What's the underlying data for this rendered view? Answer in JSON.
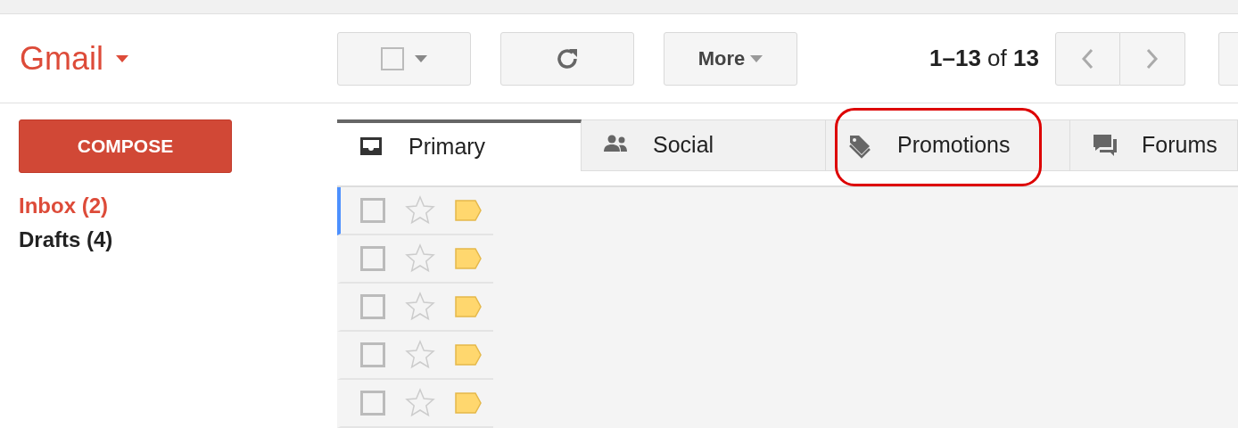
{
  "app": {
    "logo": "Gmail"
  },
  "toolbar": {
    "more_label": "More",
    "page_range": "1–13",
    "page_of": "of",
    "page_total": "13"
  },
  "sidebar": {
    "compose_label": "COMPOSE",
    "items": [
      {
        "label": "Inbox (2)",
        "selected": true
      },
      {
        "label": "Drafts (4)",
        "selected": false
      }
    ]
  },
  "tabs": [
    {
      "kind": "primary",
      "label": "Primary",
      "selected": true,
      "highlighted": false
    },
    {
      "kind": "social",
      "label": "Social",
      "selected": false,
      "highlighted": false
    },
    {
      "kind": "promotions",
      "label": "Promotions",
      "selected": false,
      "highlighted": true
    },
    {
      "kind": "forums",
      "label": "Forums",
      "selected": false,
      "highlighted": false
    }
  ],
  "rows": [
    {
      "selected": true,
      "checked": false,
      "starred": false,
      "important": true
    },
    {
      "selected": false,
      "checked": false,
      "starred": false,
      "important": true
    },
    {
      "selected": false,
      "checked": false,
      "starred": false,
      "important": true
    },
    {
      "selected": false,
      "checked": false,
      "starred": false,
      "important": true
    },
    {
      "selected": false,
      "checked": false,
      "starred": false,
      "important": true
    }
  ]
}
